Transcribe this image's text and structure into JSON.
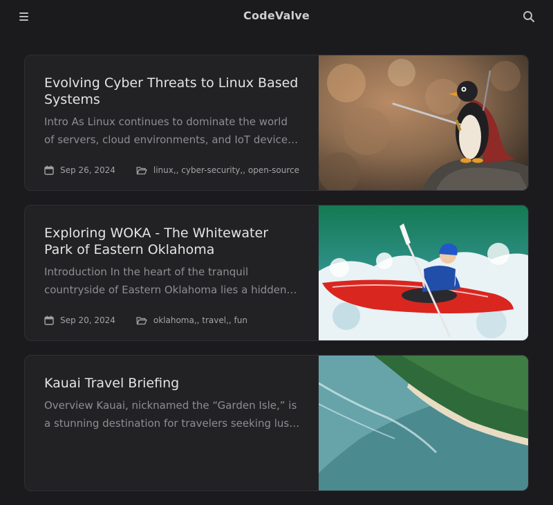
{
  "header": {
    "site_title": "CodeValve",
    "menu_icon": "hamburger-menu-icon",
    "search_icon": "search-icon"
  },
  "posts": [
    {
      "title": "Evolving Cyber Threats to Linux Based Systems",
      "excerpt": "Intro As Linux continues to dominate the world of servers, cloud environments, and IoT devices, the growing reliance on Linux-based systems has attracted attackers.",
      "date": "Sep 26, 2024",
      "categories": "linux,, cyber-security,, open-source",
      "image": "penguin-warrior-image"
    },
    {
      "title": "Exploring WOKA - The Whitewater Park of Eastern Oklahoma",
      "excerpt": "Introduction In the heart of the tranquil countryside of Eastern Oklahoma lies a hidden gem for adventure seekers.",
      "date": "Sep 20, 2024",
      "categories": "oklahoma,, travel,, fun",
      "image": "kayak-whitewater-image"
    },
    {
      "title": "Kauai Travel Briefing",
      "excerpt": "Overview Kauai, nicknamed the “Garden Isle,” is a stunning destination for travelers seeking lush landscapes.",
      "date": "",
      "categories": "",
      "image": "kauai-coastline-image"
    }
  ],
  "colors": {
    "background": "#1b1b1e",
    "card": "#222225",
    "text_muted": "#8e8e93"
  }
}
